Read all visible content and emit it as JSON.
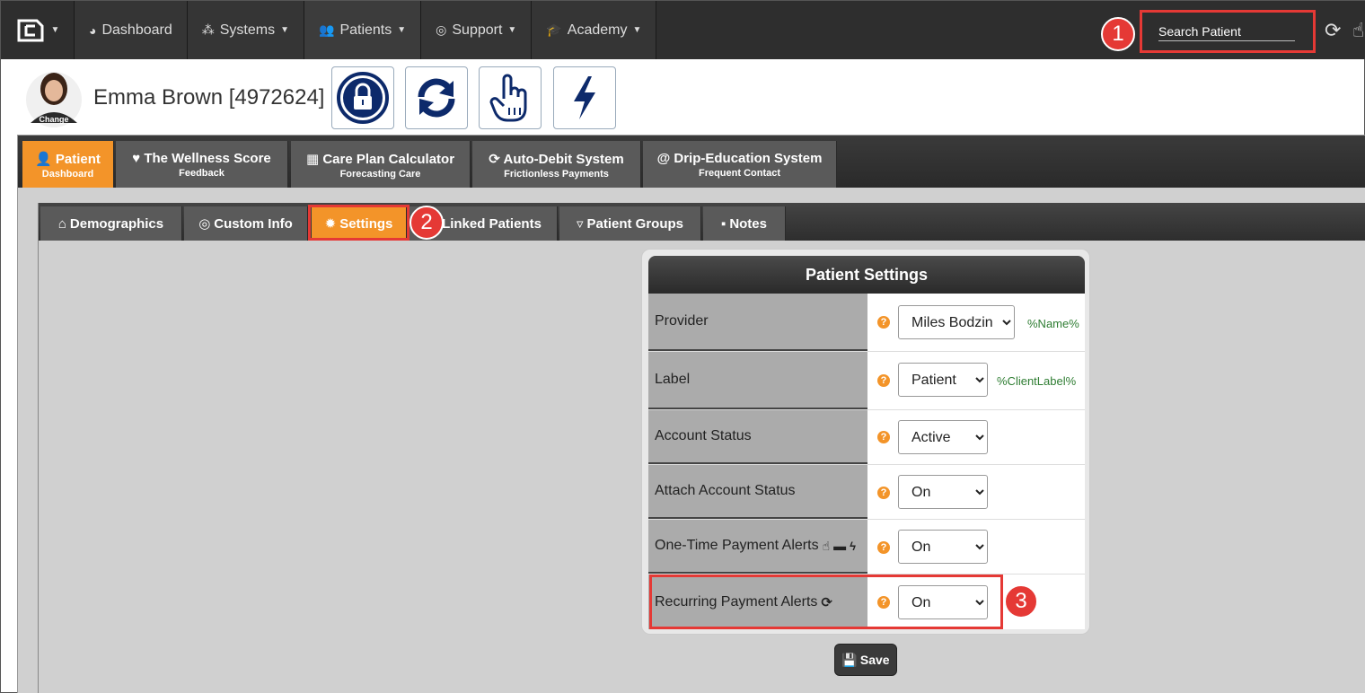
{
  "nav": {
    "items": [
      {
        "label": "Dashboard",
        "icon": "dashboard-icon",
        "caret": false
      },
      {
        "label": "Systems",
        "icon": "sitemap-icon",
        "caret": true
      },
      {
        "label": "Patients",
        "icon": "users-icon",
        "caret": true
      },
      {
        "label": "Support",
        "icon": "lifebuoy-icon",
        "caret": true
      },
      {
        "label": "Academy",
        "icon": "graduation-cap-icon",
        "caret": true
      }
    ],
    "search_placeholder": "Search Patient"
  },
  "markers": [
    "1",
    "2",
    "3"
  ],
  "patient": {
    "name": "Emma Brown [4972624]",
    "avatar_caption": "Change"
  },
  "main_tabs": [
    {
      "title": "Patient",
      "sub": "Dashboard",
      "icon": "user-icon"
    },
    {
      "title": "The Wellness Score",
      "sub": "Feedback",
      "icon": "heartbeat-icon"
    },
    {
      "title": "Care Plan Calculator",
      "sub": "Forecasting Care",
      "icon": "calculator-icon"
    },
    {
      "title": "Auto-Debit System",
      "sub": "Frictionless Payments",
      "icon": "refresh-icon"
    },
    {
      "title": "Drip-Education System",
      "sub": "Frequent Contact",
      "icon": "at-icon"
    }
  ],
  "sub_tabs": [
    {
      "label": "Demographics",
      "icon": "home-icon"
    },
    {
      "label": "Custom Info",
      "icon": "bullseye-icon"
    },
    {
      "label": "Settings",
      "icon": "gear-icon"
    },
    {
      "label": "Linked Patients",
      "icon": ""
    },
    {
      "label": "Patient Groups",
      "icon": "bucket-icon"
    },
    {
      "label": "Notes",
      "icon": "note-icon"
    }
  ],
  "settings": {
    "title": "Patient Settings",
    "rows": [
      {
        "label": "Provider",
        "value": "Miles Bodzin",
        "token": "%Name%"
      },
      {
        "label": "Label",
        "value": "Patient",
        "token": "%ClientLabel%"
      },
      {
        "label": "Account Status",
        "value": "Active",
        "token": ""
      },
      {
        "label": "Attach Account Status",
        "value": "On",
        "token": ""
      },
      {
        "label": "One-Time Payment Alerts",
        "value": "On",
        "token": ""
      },
      {
        "label": "Recurring Payment Alerts",
        "value": "On",
        "token": ""
      }
    ],
    "save_label": "Save"
  },
  "colors": {
    "accent": "#f39429",
    "highlight": "#e53935",
    "nav_bg": "#2e2e2e",
    "icon_blue": "#0d2a6b"
  }
}
